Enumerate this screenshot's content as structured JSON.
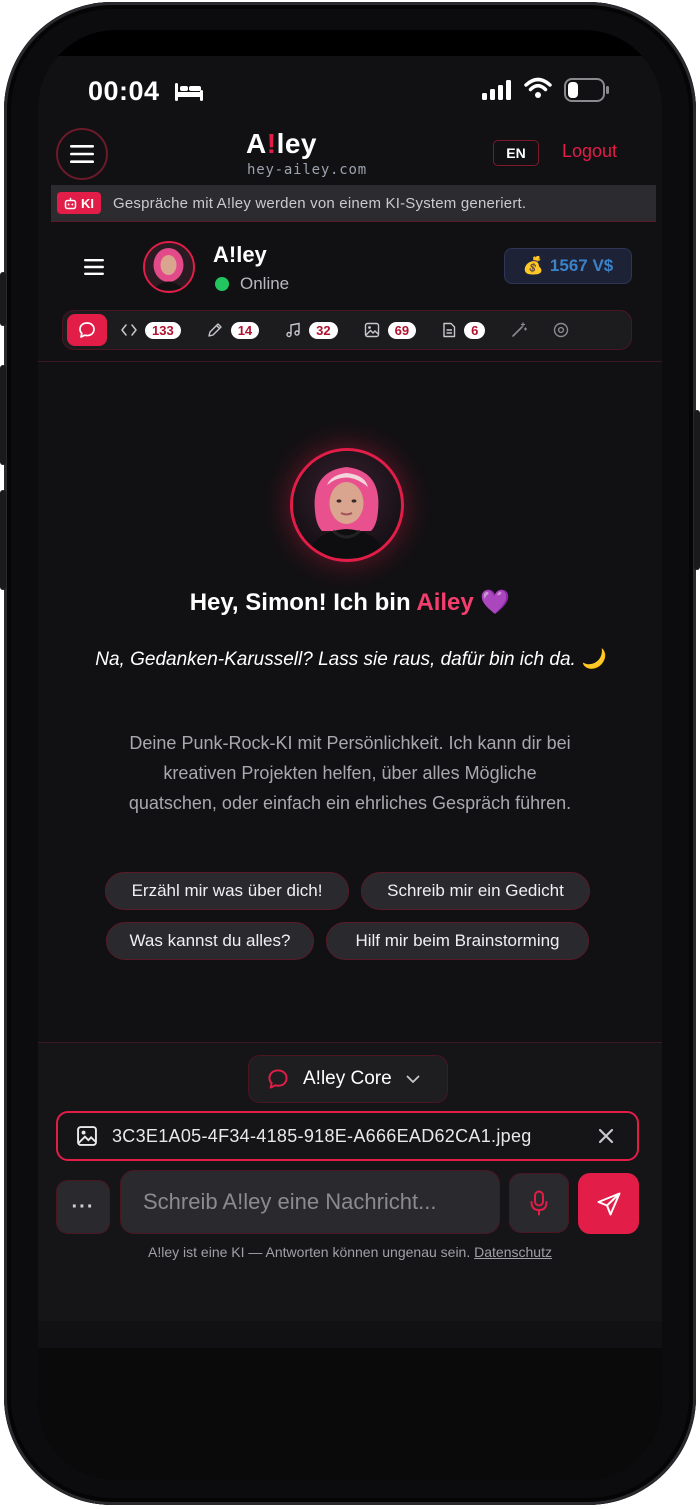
{
  "status_bar": {
    "time": "00:04"
  },
  "header": {
    "logo": {
      "prefix": "A",
      "bang": "!",
      "suffix": "ley"
    },
    "logo_sub": "hey-ailey.com",
    "language": "EN",
    "logout": "Logout"
  },
  "ki_banner": {
    "badge": "KI",
    "text": "Gespräche mit A!ley werden von einem KI-System generiert."
  },
  "profile": {
    "name": "A!ley",
    "status": "Online",
    "credits": "1567 V$"
  },
  "toolbar": {
    "tools": [
      {
        "icon": "chat-icon",
        "count": ""
      },
      {
        "icon": "code-icon",
        "count": "133"
      },
      {
        "icon": "pen-icon",
        "count": "14"
      },
      {
        "icon": "music-icon",
        "count": "32"
      },
      {
        "icon": "image-icon",
        "count": "69"
      },
      {
        "icon": "document-icon",
        "count": "6"
      },
      {
        "icon": "magic-wand-icon",
        "count": ""
      },
      {
        "icon": "disc-icon",
        "count": ""
      }
    ]
  },
  "hero": {
    "greeting_pre": "Hey, Simon! Ich bin ",
    "greeting_name": "Ailey",
    "greeting_emoji": "💜",
    "subtitle": "Na, Gedanken-Karussell? Lass sie raus, dafür bin ich da. 🌙",
    "description": "Deine Punk-Rock-KI mit Persönlichkeit. Ich kann dir bei kreativen Projekten helfen, über alles Mögliche quatschen, oder einfach ein ehrliches Gespräch führen."
  },
  "suggestions": [
    "Erzähl mir was über dich!",
    "Schreib mir ein Gedicht",
    "Was kannst du alles?",
    "Hilf mir beim Brainstorming"
  ],
  "composer": {
    "model": "A!ley Core",
    "attachment": "3C3E1A05-4F34-4185-918E-A666EAD62CA1.jpeg",
    "more": "···",
    "placeholder": "Schreib A!ley eine Nachricht...",
    "disclaimer": "A!ley ist eine KI — Antworten können ungenau sein.",
    "privacy_link": "Datenschutz"
  },
  "colors": {
    "accent": "#e11d48",
    "background": "#111113",
    "online": "#22c55e",
    "credits": "#3b82c8"
  }
}
